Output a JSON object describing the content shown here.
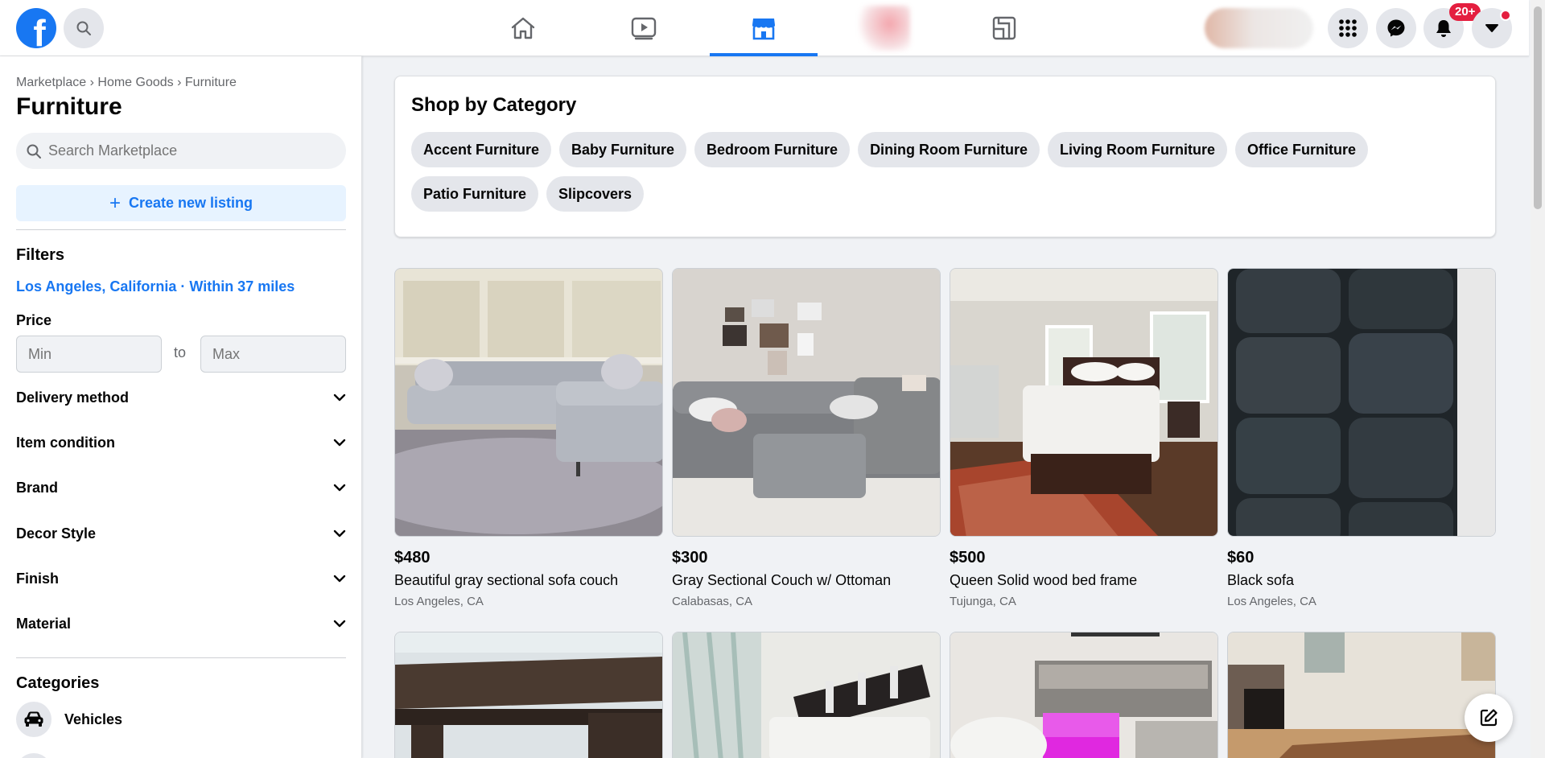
{
  "header": {
    "logo_letter": "f",
    "notification_badge": "20+"
  },
  "sidebar": {
    "breadcrumb": {
      "parts": [
        "Marketplace",
        "Home Goods",
        "Furniture"
      ],
      "sep": "›"
    },
    "title": "Furniture",
    "search_placeholder": "Search Marketplace",
    "create_listing": "Create new listing",
    "filters_heading": "Filters",
    "location": "Los Angeles, California · Within 37 miles",
    "price_label": "Price",
    "price_min_placeholder": "Min",
    "price_max_placeholder": "Max",
    "price_to": "to",
    "filters": [
      "Delivery method",
      "Item condition",
      "Brand",
      "Decor Style",
      "Finish",
      "Material"
    ],
    "categories_heading": "Categories",
    "categories": [
      "Vehicles"
    ]
  },
  "shop": {
    "title": "Shop by Category",
    "chips": [
      "Accent Furniture",
      "Baby Furniture",
      "Bedroom Furniture",
      "Dining Room Furniture",
      "Living Room Furniture",
      "Office Furniture",
      "Patio Furniture",
      "Slipcovers"
    ]
  },
  "listings": [
    {
      "price": "$480",
      "title": "Beautiful gray sectional sofa couch",
      "location": "Los Angeles, CA"
    },
    {
      "price": "$300",
      "title": "Gray Sectional Couch w/ Ottoman",
      "location": "Calabasas, CA"
    },
    {
      "price": "$500",
      "title": "Queen Solid wood bed frame",
      "location": "Tujunga, CA"
    },
    {
      "price": "$60",
      "title": "Black sofa",
      "location": "Los Angeles, CA"
    }
  ],
  "colors": {
    "accent": "#1877f2",
    "badge": "#e41e3f",
    "surface": "#f0f2f5"
  }
}
